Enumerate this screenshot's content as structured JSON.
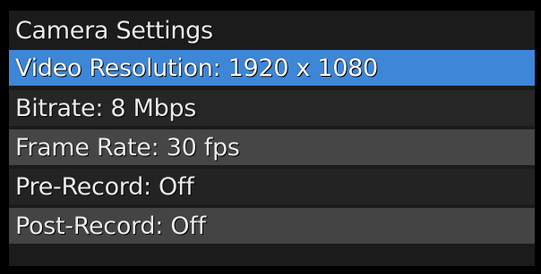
{
  "menu": {
    "title": "Camera Settings",
    "items": [
      {
        "label": "Video Resolution: 1920 x 1080",
        "selected": true
      },
      {
        "label": "Bitrate: 8 Mbps",
        "selected": false
      },
      {
        "label": "Frame Rate: 30 fps",
        "selected": false
      },
      {
        "label": "Pre-Record: Off",
        "selected": false
      },
      {
        "label": "Post-Record: Off",
        "selected": false
      }
    ]
  },
  "colors": {
    "background": "#000000",
    "panel": "#1b1b1b",
    "highlight": "#3d86d8",
    "row_dark": "#262626",
    "row_light": "#464646",
    "text": "#ececec"
  }
}
